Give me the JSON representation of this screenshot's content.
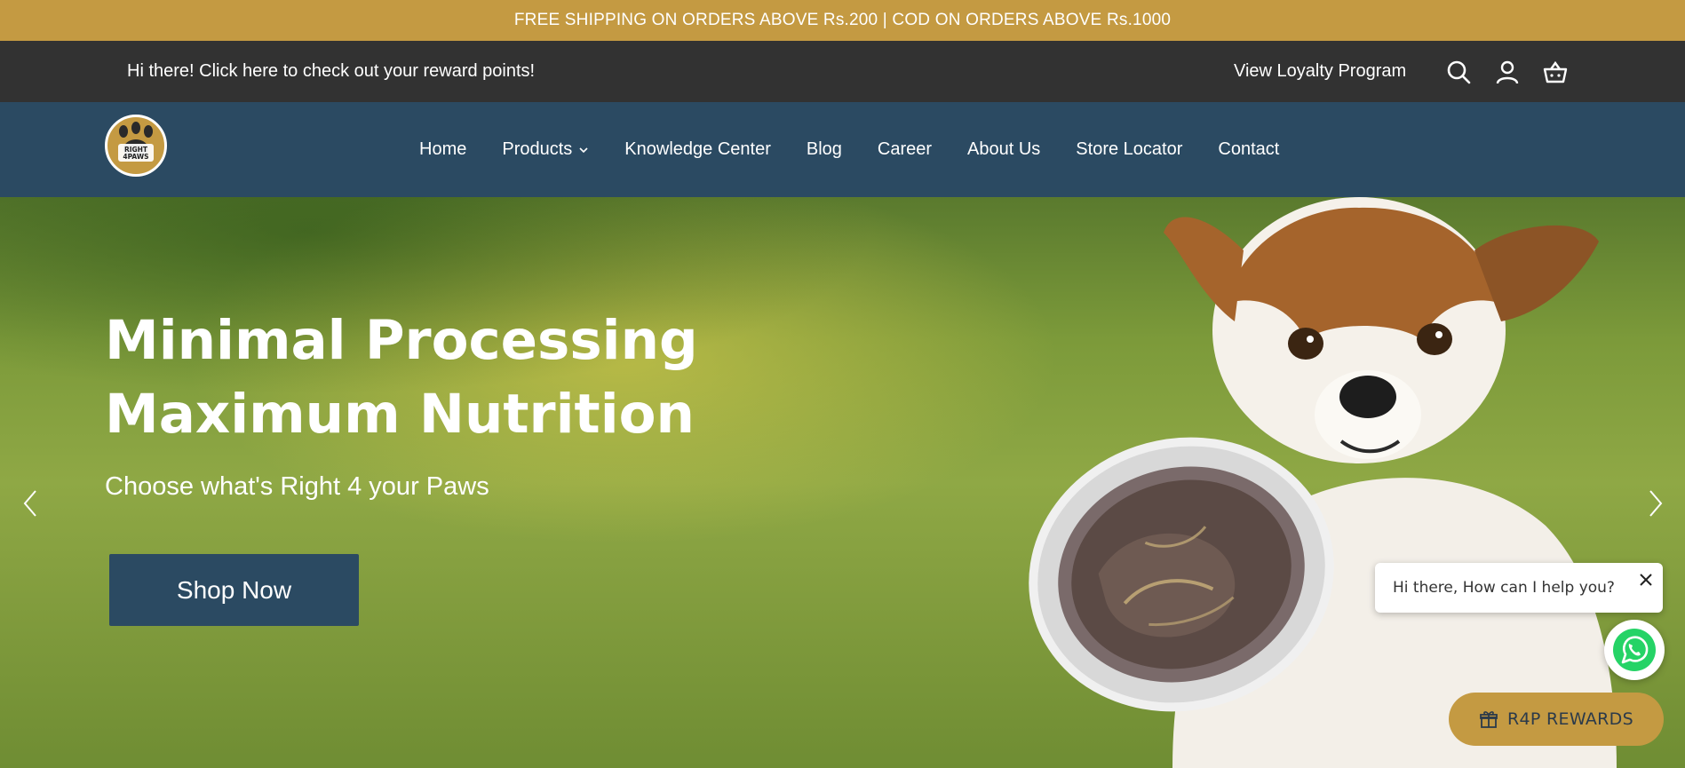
{
  "announcement": {
    "text": "FREE SHIPPING ON ORDERS ABOVE Rs.200 | COD ON ORDERS ABOVE Rs.1000"
  },
  "topbar": {
    "greeting": "Hi there! Click here to check out your reward points!",
    "loyalty_link": "View Loyalty Program",
    "icons": [
      "search-icon",
      "account-icon",
      "cart-icon"
    ]
  },
  "nav": {
    "logo_text": "RIGHT 4PAWS",
    "items": [
      {
        "label": "Home"
      },
      {
        "label": "Products"
      },
      {
        "label": "Knowledge Center"
      },
      {
        "label": "Blog"
      },
      {
        "label": "Career"
      },
      {
        "label": "About Us"
      },
      {
        "label": "Store Locator"
      },
      {
        "label": "Contact"
      }
    ]
  },
  "hero": {
    "title_line1": "Minimal Processing",
    "title_line2": "Maximum Nutrition",
    "subtitle": "Choose what's Right 4 your Paws",
    "cta": "Shop Now"
  },
  "chat": {
    "message": "Hi there, How can I help you?"
  },
  "rewards": {
    "label": "R4P REWARDS"
  },
  "colors": {
    "gold": "#c49a42",
    "dark_bar": "#323232",
    "navy": "#2b4a62",
    "whatsapp": "#25d366"
  }
}
